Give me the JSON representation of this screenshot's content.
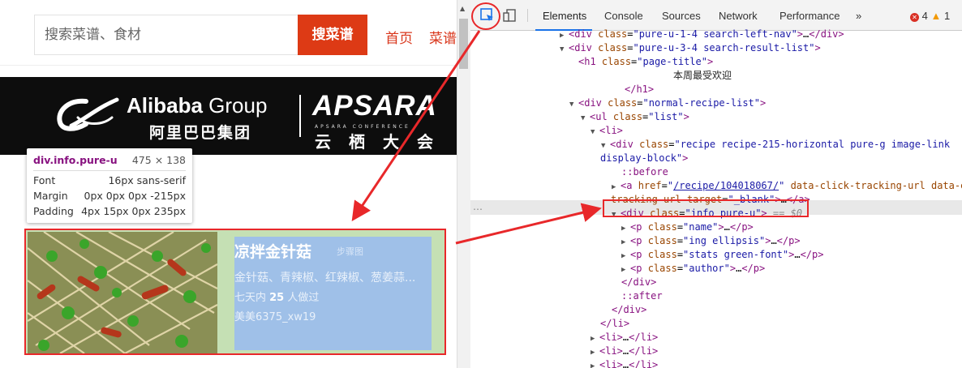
{
  "header": {
    "search_placeholder": "搜索菜谱、食材",
    "search_button": "搜菜谱",
    "nav": [
      "首页",
      "菜谱"
    ]
  },
  "banner": {
    "brand_en_bold": "Alibaba",
    "brand_en_light": " Group",
    "brand_cn": "阿里巴巴集团",
    "event_title": "APSARA",
    "event_sub": "APSARA CONFERENCE",
    "event_cn": "云栖大会"
  },
  "page_title": "本周最受欢迎",
  "page_title_visible": "迎",
  "tooltip": {
    "selector": "div.info.pure-u",
    "size": "475 × 138",
    "rows": [
      {
        "label": "Font",
        "value": "16px sans-serif"
      },
      {
        "label": "Margin",
        "value": "0px 0px 0px -215px"
      },
      {
        "label": "Padding",
        "value": "4px 15px 0px 235px"
      }
    ]
  },
  "recipe": {
    "name": "凉拌金针菇",
    "steps_badge": "步骤图",
    "ingredients": "金针菇、青辣椒、红辣椒、葱姜蒜...",
    "stats_prefix": "七天内 ",
    "stats_count": "25",
    "stats_suffix": " 人做过",
    "author": "美美6375_xw19"
  },
  "devtools": {
    "tabs": [
      "Elements",
      "Console",
      "Sources",
      "Network",
      "Performance",
      "»"
    ],
    "active_tab": "Elements",
    "errors": "4",
    "warnings": "1",
    "selected_suffix": "== $0"
  },
  "colors": {
    "brand_red": "#dd3a15",
    "highlight_red": "#e8282a",
    "content_overlay": "#9fc0e8",
    "padding_overlay": "#c5e0b4"
  }
}
